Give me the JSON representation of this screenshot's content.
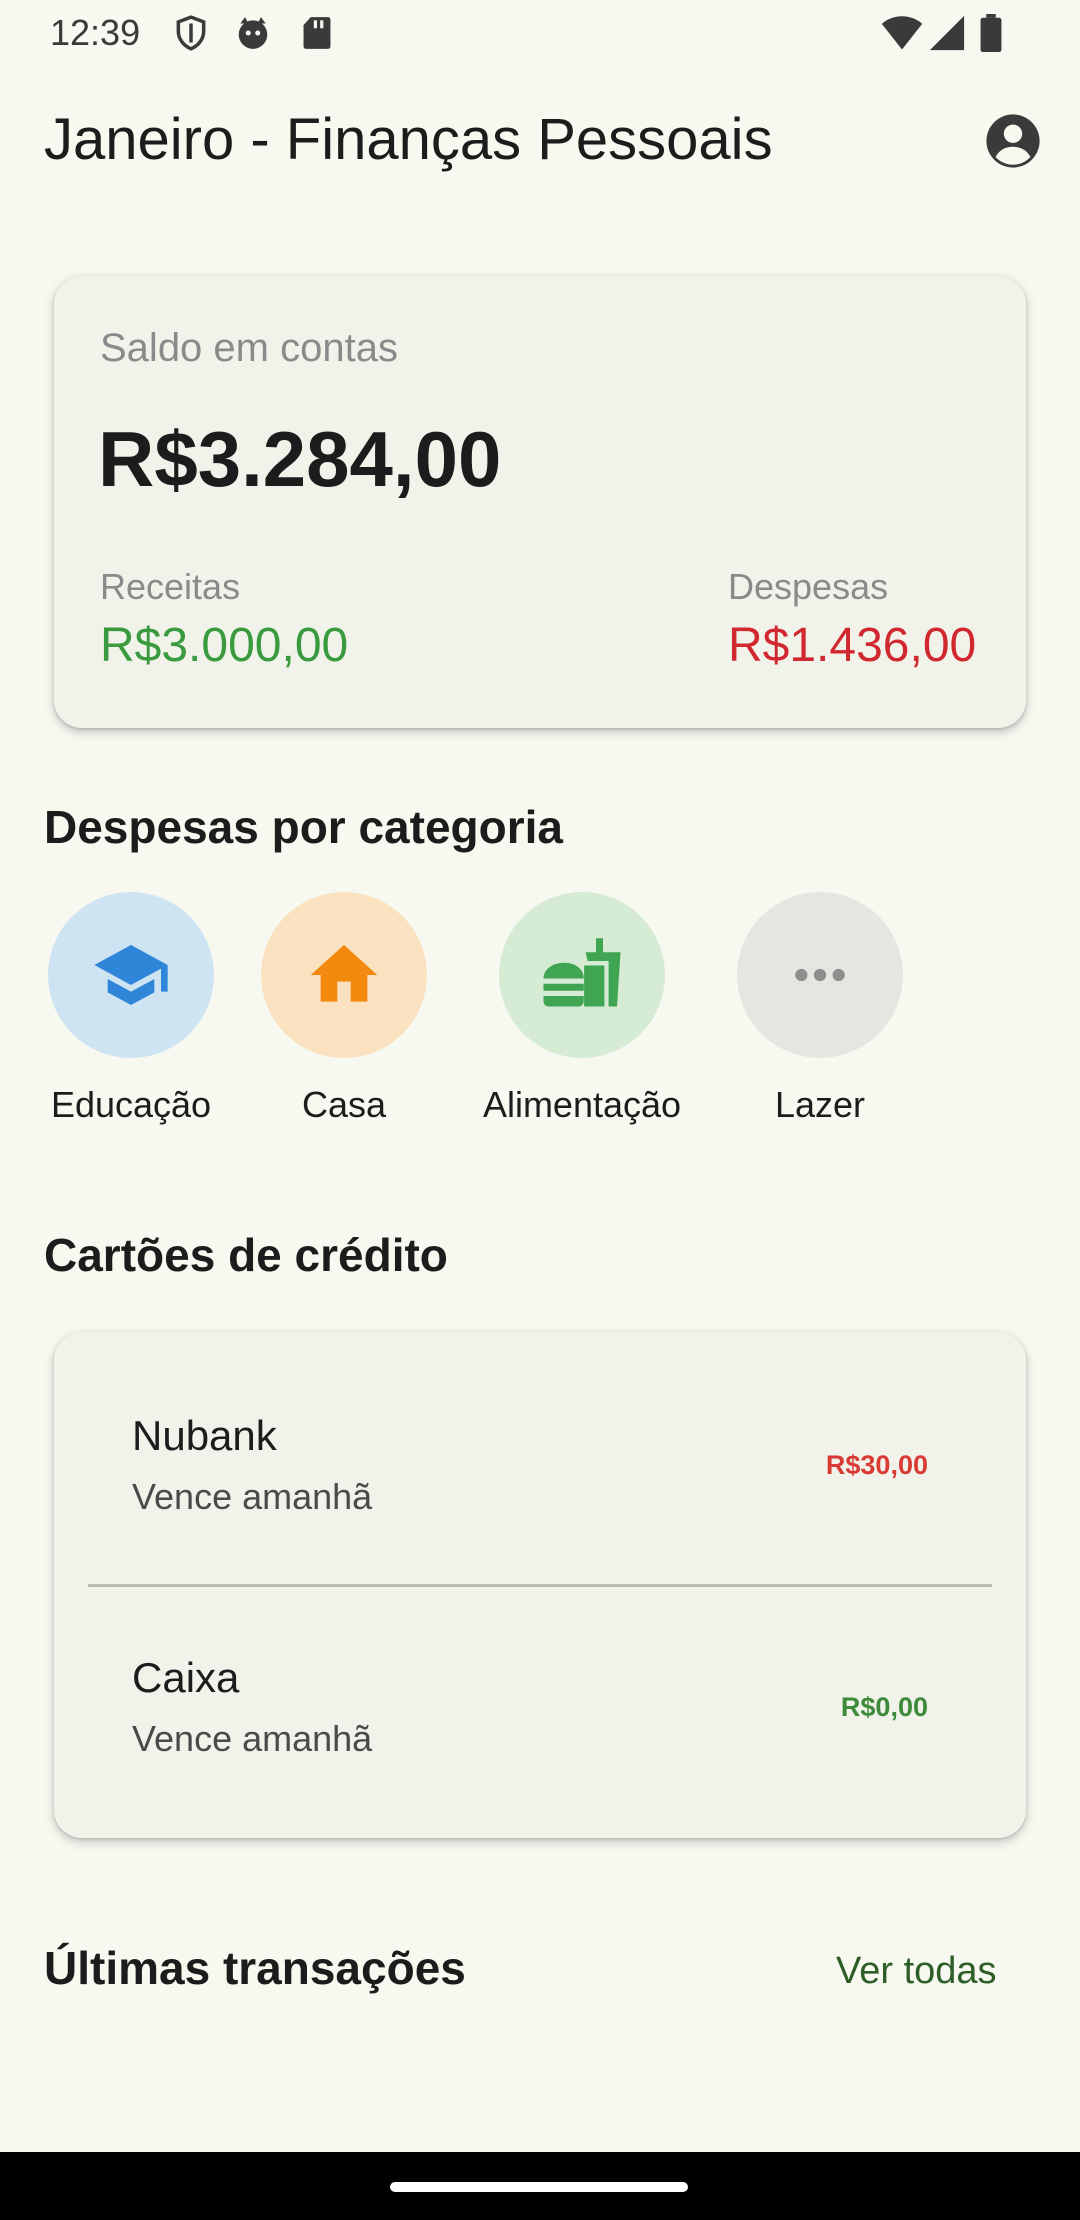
{
  "status_bar": {
    "time": "12:39",
    "icons": [
      "shield-icon",
      "cat-icon",
      "sd-card-icon",
      "wifi-icon",
      "signal-icon",
      "battery-icon"
    ]
  },
  "header": {
    "title": "Janeiro - Finanças Pessoais",
    "profile_icon": "account-circle-icon"
  },
  "balance": {
    "label": "Saldo em contas",
    "value": "R$3.284,00",
    "income_label": "Receitas",
    "income_value": "R$3.000,00",
    "expense_label": "Despesas",
    "expense_value": "R$1.436,00"
  },
  "categories": {
    "title": "Despesas por categoria",
    "items": [
      {
        "label": "Educação",
        "icon": "school-icon",
        "color": "#2f86d8",
        "bg": "#cfe4f2"
      },
      {
        "label": "Casa",
        "icon": "home-icon",
        "color": "#f38a0f",
        "bg": "#fae2c0"
      },
      {
        "label": "Alimentação",
        "icon": "fastfood-icon",
        "color": "#3fa552",
        "bg": "#d6ebd4"
      },
      {
        "label": "Lazer",
        "icon": "more-horiz-icon",
        "color": "#8e8e8e",
        "bg": "#e6e6e0"
      }
    ]
  },
  "credit_cards": {
    "title": "Cartões de crédito",
    "items": [
      {
        "name": "Nubank",
        "due": "Vence amanhã",
        "amount": "R$30,00",
        "amount_color": "#d93a33"
      },
      {
        "name": "Caixa",
        "due": "Vence amanhã",
        "amount": "R$0,00",
        "amount_color": "#3c8a3a"
      }
    ]
  },
  "transactions": {
    "title": "Últimas transações",
    "see_all": "Ver todas"
  },
  "colors": {
    "background": "#f7f8f0",
    "card": "#f1f3eb",
    "income": "#3a9a3e",
    "expense": "#d0282e",
    "link": "#2e5e28"
  }
}
